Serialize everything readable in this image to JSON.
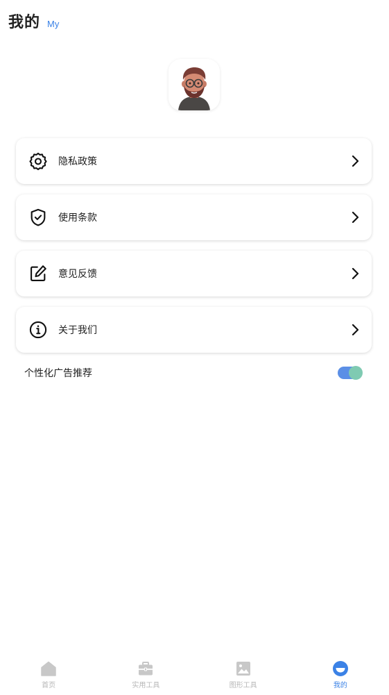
{
  "header": {
    "title": "我的",
    "subtitle": "My"
  },
  "menu": [
    {
      "label": "隐私政策",
      "icon": "gear-icon"
    },
    {
      "label": "使用条款",
      "icon": "shield-check-icon"
    },
    {
      "label": "意见反馈",
      "icon": "edit-icon"
    },
    {
      "label": "关于我们",
      "icon": "info-icon"
    }
  ],
  "settings": {
    "personalized_ads_label": "个性化广告推荐",
    "personalized_ads_enabled": true
  },
  "tabs": [
    {
      "label": "首页",
      "icon": "home-icon",
      "active": false
    },
    {
      "label": "实用工具",
      "icon": "toolbox-icon",
      "active": false
    },
    {
      "label": "图形工具",
      "icon": "image-icon",
      "active": false
    },
    {
      "label": "我的",
      "icon": "profile-icon",
      "active": true
    }
  ],
  "colors": {
    "accent": "#3b82e6",
    "toggle_track": "#5b8fe6",
    "toggle_knob": "#7fcab2",
    "inactive_tab": "#b7b7b7"
  }
}
